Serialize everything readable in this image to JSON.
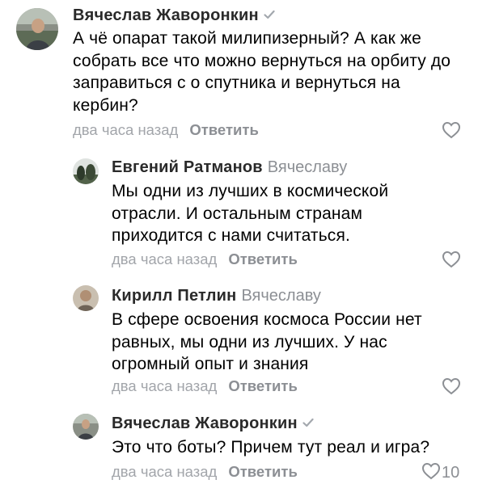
{
  "comments": [
    {
      "author": "Вячеслав Жаворонкин",
      "verified_icon": "verified-check-icon",
      "reply_to": "",
      "text": "А чё опарат такой милипизерный? А как же собрать все что можно вернуться на орбиту до заправиться с о спутника и вернуться на кербин?",
      "time": "два часа назад",
      "reply_label": "Ответить",
      "likes": ""
    },
    {
      "author": "Евгений Ратманов",
      "reply_to": "Вячеславу",
      "text": "Мы одни из лучших в космической отрасли. И остальным странам приходится с нами считаться.",
      "time": "два часа назад",
      "reply_label": "Ответить",
      "likes": ""
    },
    {
      "author": "Кирилл Петлин",
      "reply_to": "Вячеславу",
      "text": "В сфере освоения космоса России нет равных, мы одни из лучших. У нас огромный опыт и знания",
      "time": "два часа назад",
      "reply_label": "Ответить",
      "likes": ""
    },
    {
      "author": "Вячеслав Жаворонкин",
      "verified_icon": "verified-check-icon",
      "reply_to": "",
      "text": "Это что боты? Причем тут реал и игра?",
      "time": "два часа назад",
      "reply_label": "Ответить",
      "likes": "10"
    }
  ],
  "icons": {
    "like": "heart-outline-icon",
    "verified": "checkmark-icon"
  },
  "colors": {
    "secondary_text": "#8c8f94",
    "time_text": "#a2a5aa",
    "name_text": "#2a2a2a"
  }
}
